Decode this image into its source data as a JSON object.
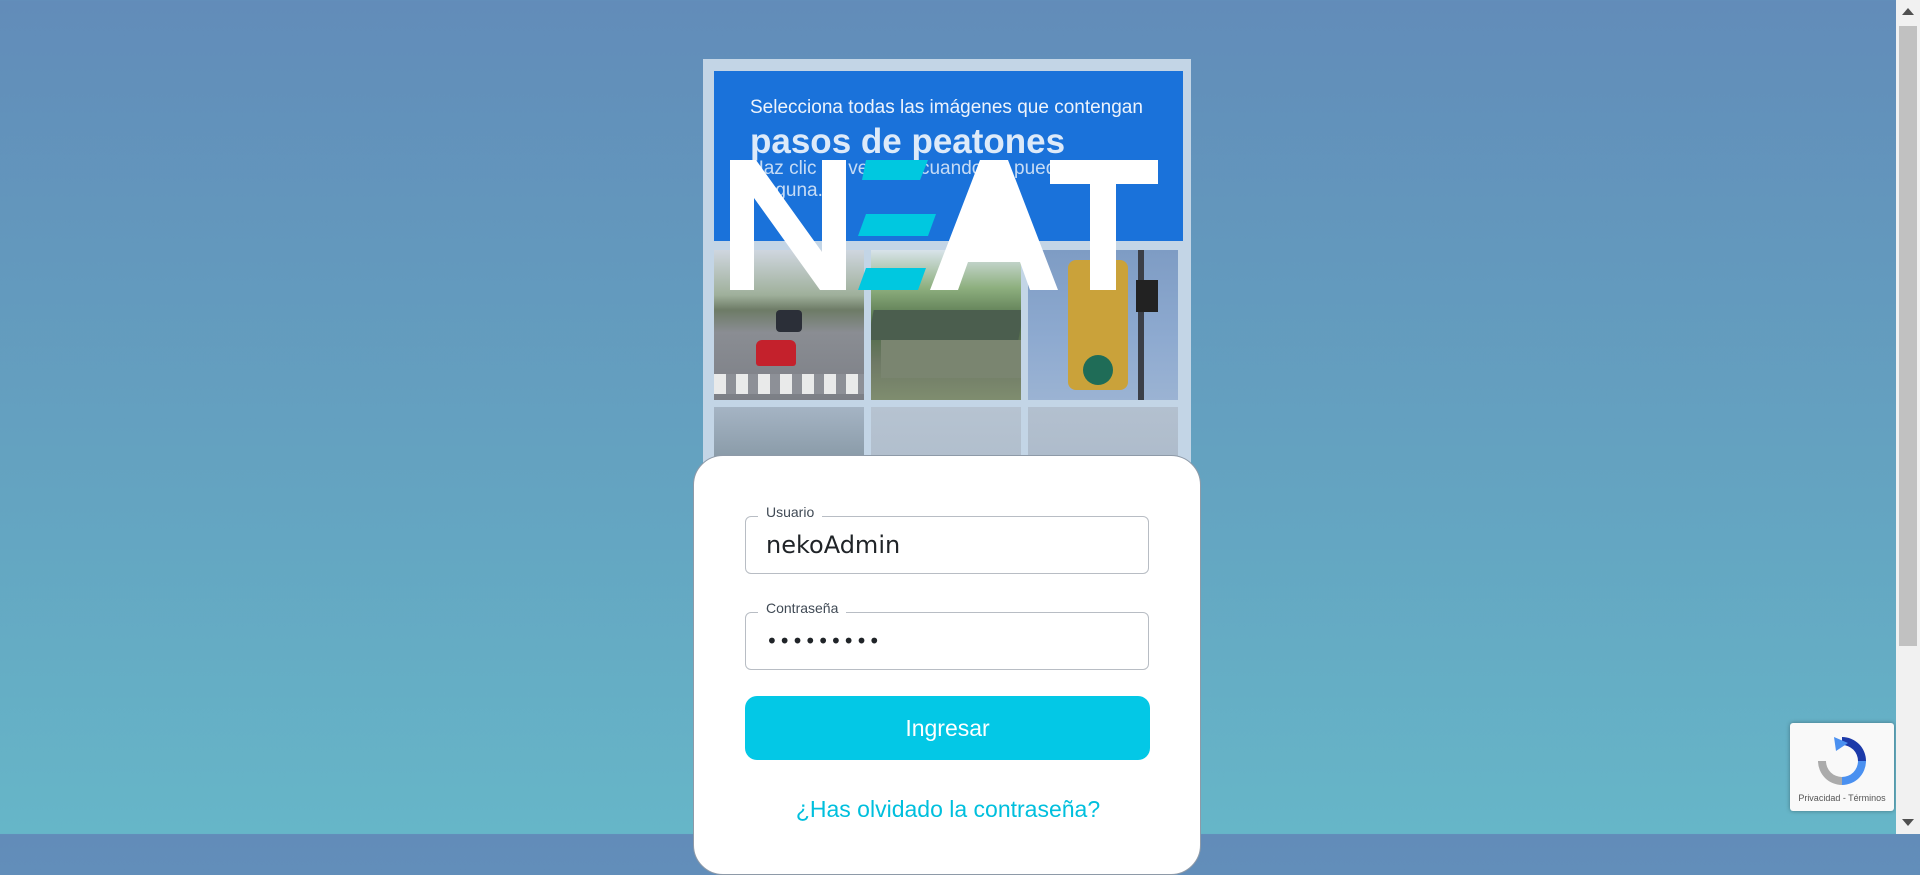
{
  "captcha": {
    "instruction": "Selecciona todas las imágenes que contengan",
    "keyword": "pasos de peatones",
    "hint": "Haz clic en verificar cuando no puedas ver ninguna."
  },
  "logo": {
    "text": "NEAT",
    "accent_color": "#00c8e0"
  },
  "login": {
    "username_label": "Usuario",
    "username_value": "nekoAdmin",
    "password_label": "Contraseña",
    "password_value": "nekoAdmin",
    "submit_label": "Ingresar",
    "forgot_label": "¿Has olvidado la contraseña?",
    "accent_color": "#03c8e6"
  },
  "recaptcha": {
    "links": "Privacidad - Términos"
  }
}
